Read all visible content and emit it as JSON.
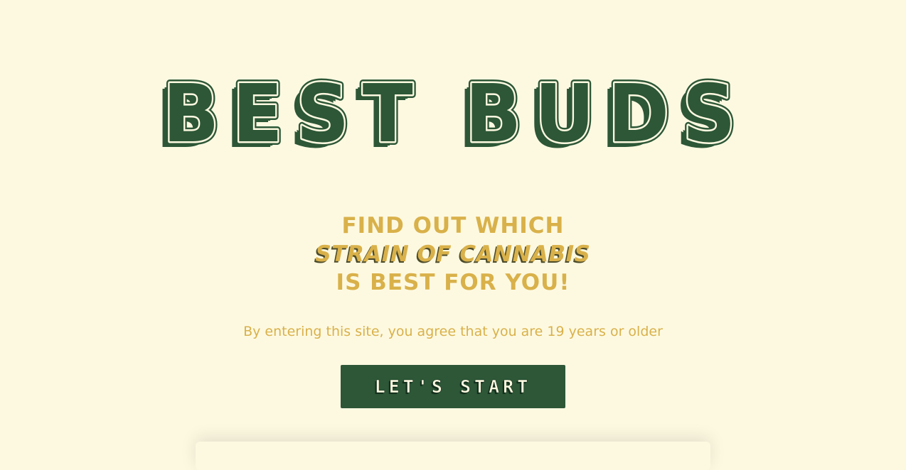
{
  "brand": {
    "title": "BEST BUDS",
    "fill_color": "#fdf9e1",
    "stroke_color": "#2d5737"
  },
  "tagline": {
    "line1": "FIND OUT WHICH",
    "line2": "STRAIN OF CANNABIS",
    "line3": "IS BEST FOR YOU!",
    "color": "#d9b14a"
  },
  "disclaimer": "By entering this site, you agree that you are 19 years or older",
  "cta": {
    "label": "LET'S START",
    "background": "#2d5737"
  },
  "colors": {
    "background": "#fdf9e1",
    "accent_green": "#2d5737",
    "accent_gold": "#d9b14a"
  }
}
